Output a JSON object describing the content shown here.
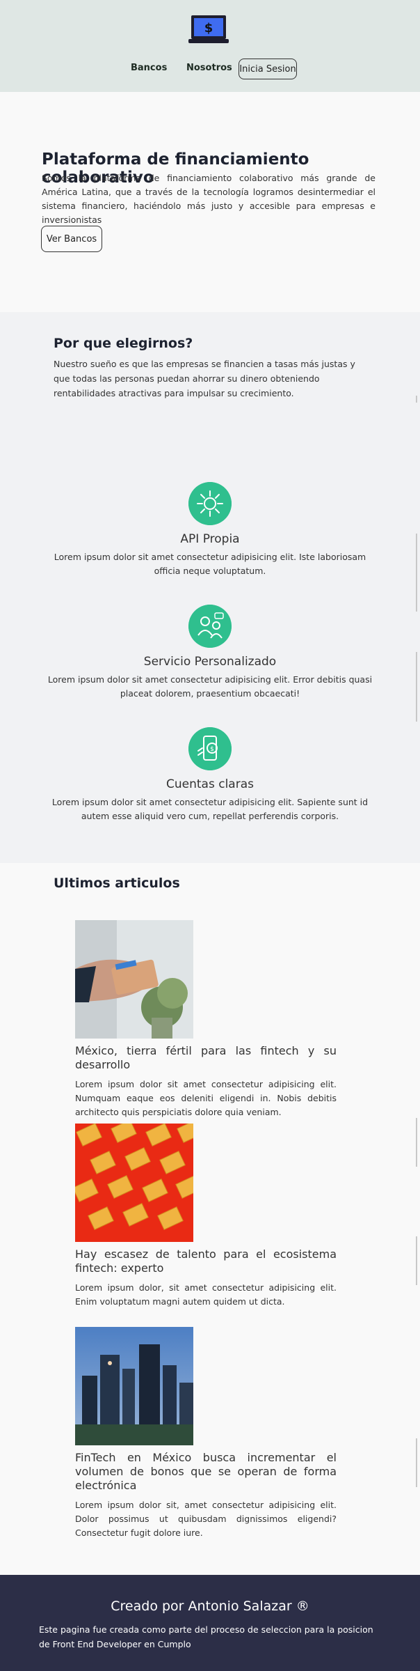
{
  "colors": {
    "header_bg": "#dfe7e4",
    "accent_green": "#2fbf8e",
    "footer_bg": "#2c2e47",
    "section_alt_bg": "#f1f2f4"
  },
  "header": {
    "logo_icon": "money-screen-icon",
    "logo_symbol": "$",
    "nav": {
      "bancos": "Bancos",
      "nosotros": "Nosotros",
      "login": "Inicia Sesion"
    }
  },
  "hero": {
    "title": "Plataforma de financiamiento colaborativo",
    "text": "Somos la plataforma de financiamiento colaborativo más grande de América Latina, que a través de la tecnología logramos desintermediar el sistema financiero, haciéndolo más justo y accesible para empresas e inversionistas",
    "button": "Ver Bancos"
  },
  "why": {
    "title": "Por que elegirnos?",
    "text": "Nuestro sueño es que las empresas se financien a tasas más justas y que todas las personas puedan ahorrar su dinero obteniendo rentabilidades atractivas para impulsar su crecimiento.",
    "features": [
      {
        "icon": "api-chip-icon",
        "title": "API Propia",
        "text": "Lorem ipsum dolor sit amet consectetur adipisicing elit. Iste laboriosam officia neque voluptatum."
      },
      {
        "icon": "personal-service-icon",
        "title": "Servicio Personalizado",
        "text": "Lorem ipsum dolor sit amet consectetur adipisicing elit. Error debitis quasi placeat dolorem, praesentium obcaecati!"
      },
      {
        "icon": "mobile-payment-icon",
        "title": "Cuentas claras",
        "text": "Lorem ipsum dolor sit amet consectetur adipisicing elit. Sapiente sunt id autem esse aliquid vero cum, repellat perferendis corporis."
      }
    ]
  },
  "articles": {
    "title": "Ultimos articulos",
    "items": [
      {
        "image": "wallet-in-hand-photo",
        "title": "México, tierra fértil para las fintech y su desarrollo",
        "text": "Lorem ipsum dolor sit amet consectetur adipisicing elit. Numquam eaque eos deleniti eligendi in. Nobis debitis architecto quis perspiciatis dolore quia veniam."
      },
      {
        "image": "gift-boxes-photo",
        "title": "Hay escasez de talento para el ecosistema fintech: experto",
        "text": "Lorem ipsum dolor, sit amet consectetur adipisicing elit. Enim voluptatum magni autem quidem ut dicta."
      },
      {
        "image": "city-skyline-photo",
        "title": "FinTech en México busca incrementar el volumen de bonos que se operan de forma electrónica",
        "text": "Lorem ipsum dolor sit, amet consectetur adipisicing elit. Dolor possimus ut quibusdam dignissimos eligendi? Consectetur fugit dolore iure."
      }
    ]
  },
  "footer": {
    "title": "Creado por Antonio Salazar ®",
    "text": "Este pagina fue creada como parte del proceso de seleccion para la posicion de Front End Developer en Cumplo"
  }
}
